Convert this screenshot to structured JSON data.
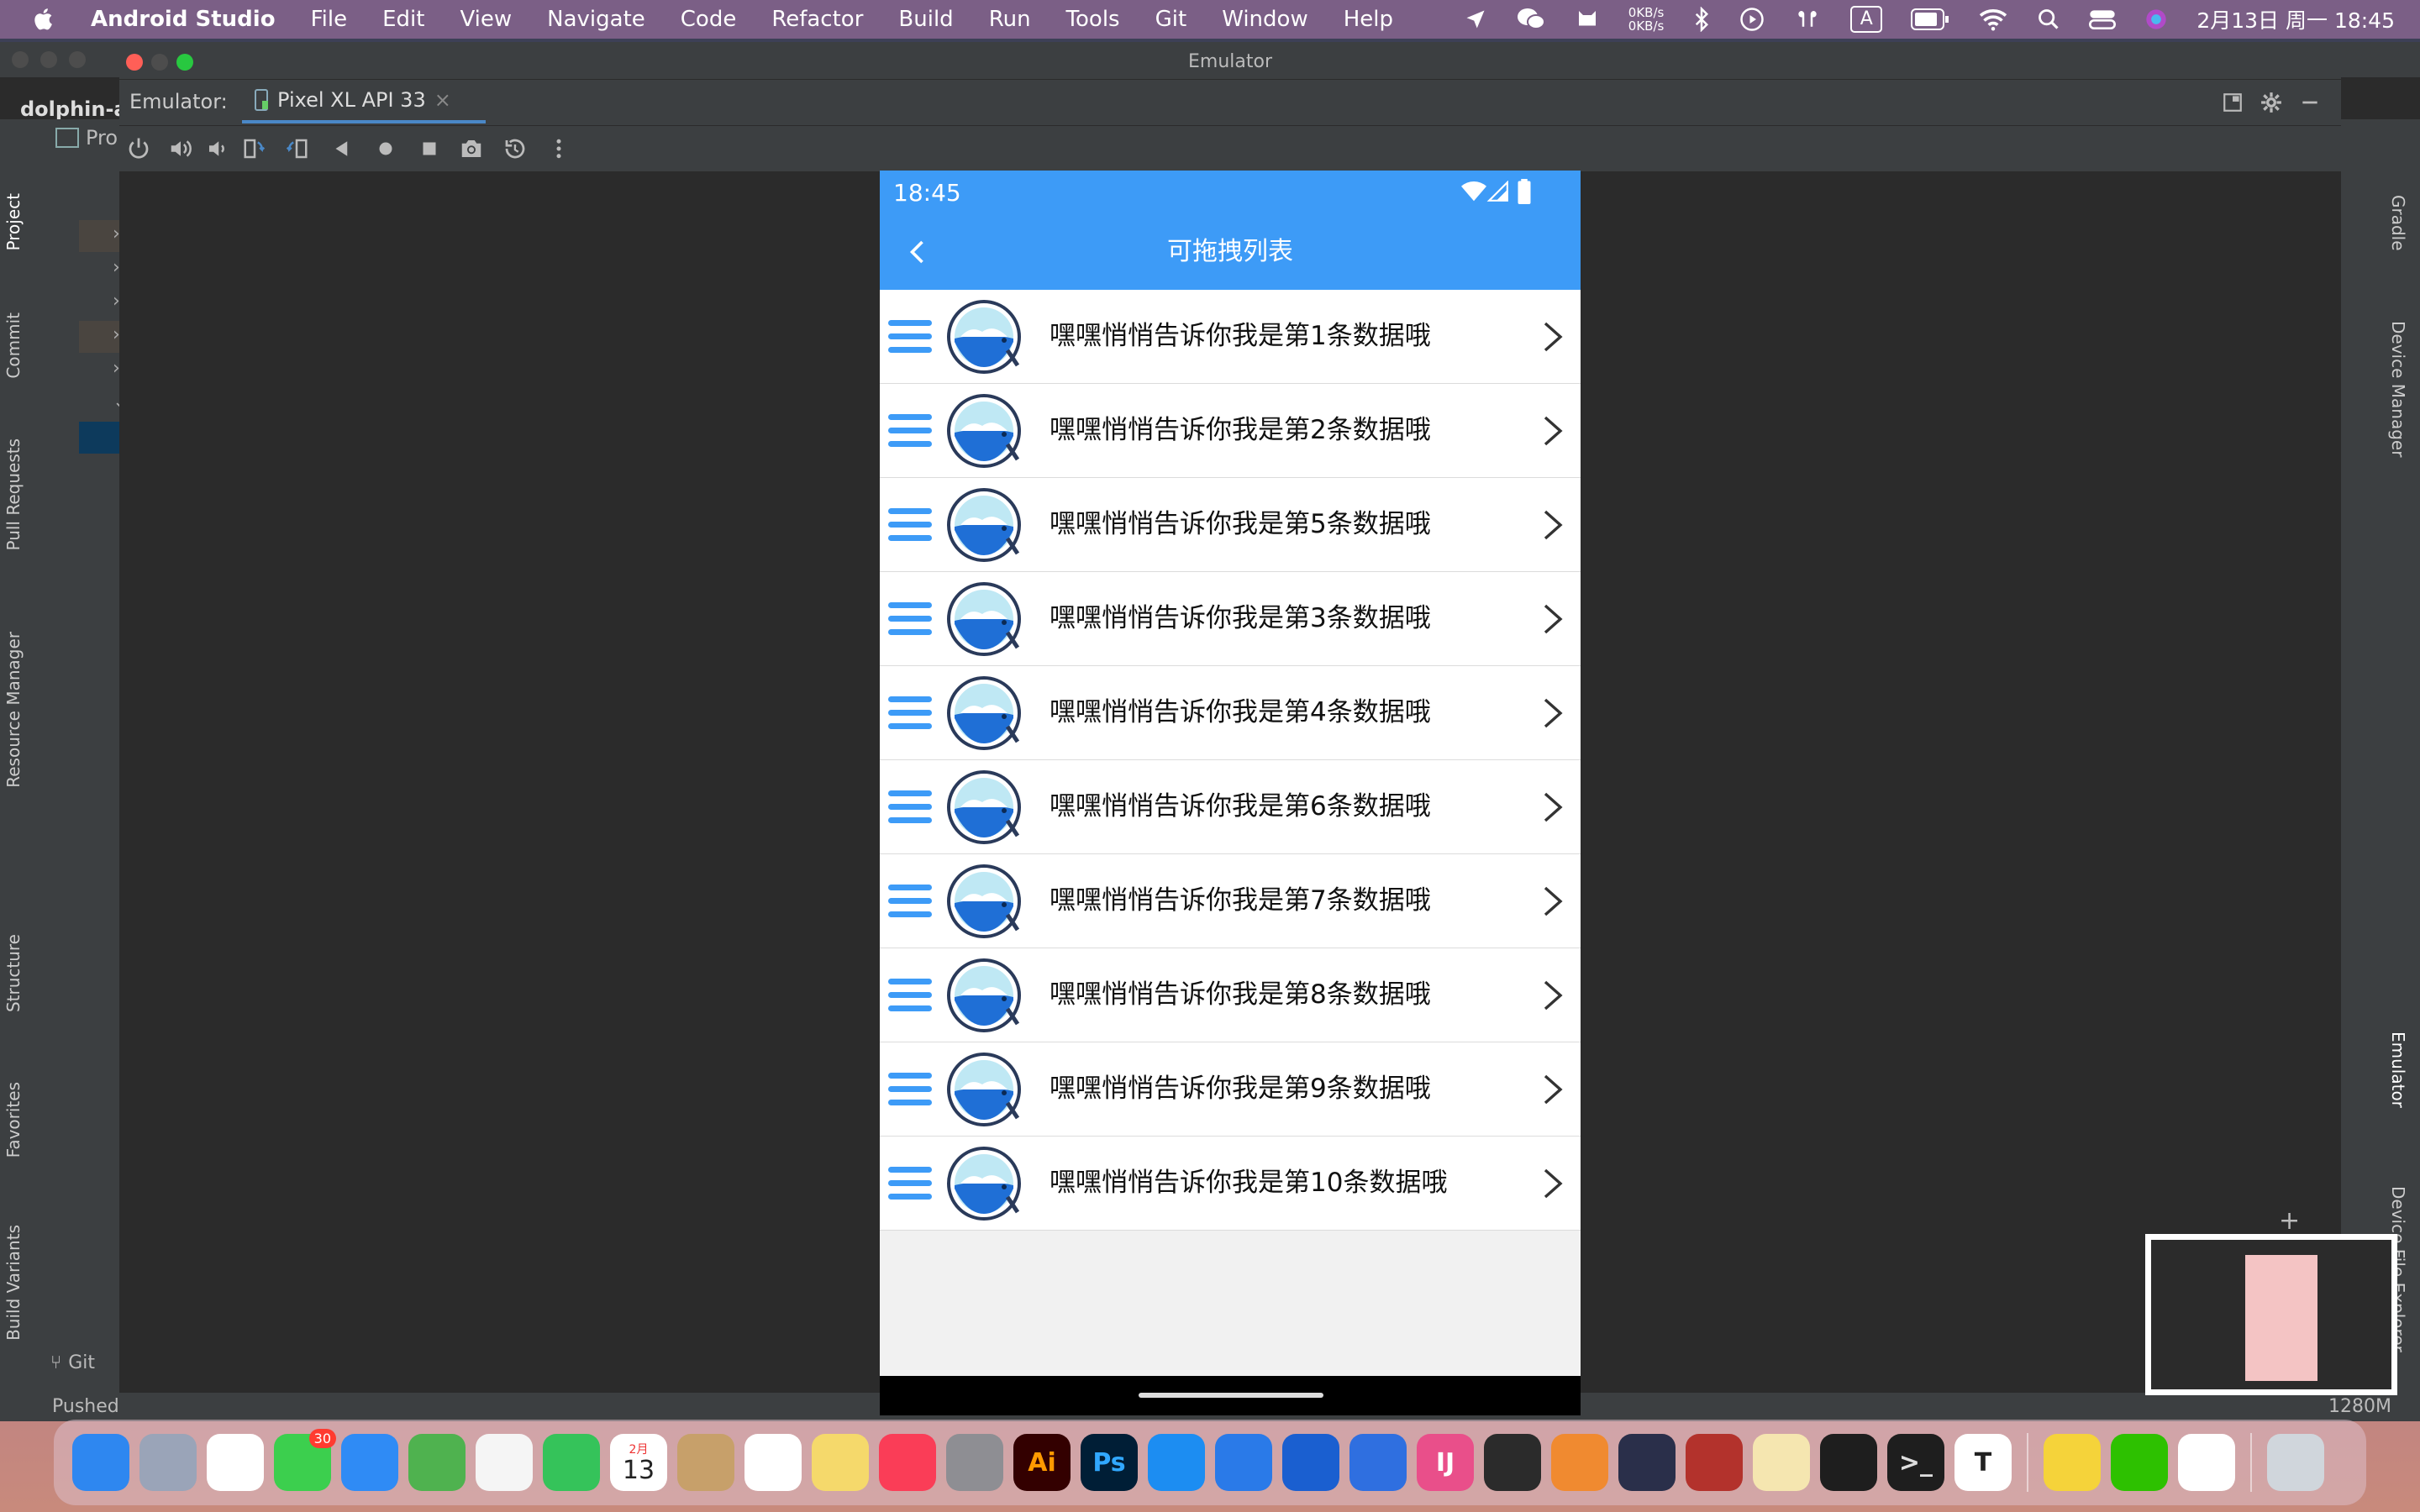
{
  "menubar": {
    "app_name": "Android Studio",
    "items": [
      "File",
      "Edit",
      "View",
      "Navigate",
      "Code",
      "Refactor",
      "Build",
      "Run",
      "Tools",
      "Git",
      "Window",
      "Help"
    ],
    "net_up": "0KB/s",
    "net_down": "0KB/s",
    "input_method": "A",
    "clock": "2月13日 周一  18:45"
  },
  "ide": {
    "project_name": "dolphin-a",
    "left_tabs": [
      "Project",
      "Commit",
      "Pull Requests",
      "Resource Manager",
      "Structure",
      "Favorites",
      "Build Variants"
    ],
    "right_tabs": [
      "Gradle",
      "Device Manager",
      "Emulator",
      "Device File Explorer"
    ],
    "git_label": "Git",
    "status_text": "Pushed",
    "memory": "1280M",
    "panel_fragment": "Pro"
  },
  "emulator": {
    "window_title": "Emulator",
    "label": "Emulator:",
    "device_tab": "Pixel XL API 33",
    "close_glyph": "×"
  },
  "phone": {
    "time": "18:45",
    "title": "可拖拽列表",
    "rows": [
      "嘿嘿悄悄告诉你我是第1条数据哦",
      "嘿嘿悄悄告诉你我是第2条数据哦",
      "嘿嘿悄悄告诉你我是第5条数据哦",
      "嘿嘿悄悄告诉你我是第3条数据哦",
      "嘿嘿悄悄告诉你我是第4条数据哦",
      "嘿嘿悄悄告诉你我是第6条数据哦",
      "嘿嘿悄悄告诉你我是第7条数据哦",
      "嘿嘿悄悄告诉你我是第8条数据哦",
      "嘿嘿悄悄告诉你我是第9条数据哦",
      "嘿嘿悄悄告诉你我是第10条数据哦"
    ]
  },
  "dock": {
    "messages_badge": "30",
    "calendar_month": "2月",
    "calendar_day": "13",
    "icons": [
      "finder-icon",
      "launchpad-icon",
      "chrome-icon",
      "messages-icon",
      "mail-icon",
      "maps-icon",
      "photos-icon",
      "facetime-icon",
      "calendar-icon",
      "contacts-icon",
      "reminders-icon",
      "notes-icon",
      "music-icon",
      "system-preferences-icon",
      "illustrator-icon",
      "photoshop-icon",
      "app-store-icon",
      "xcode-helper-icon",
      "xcode-icon",
      "instruments-icon",
      "intellij-icon",
      "android-studio-icon",
      "pencil-icon",
      "cloud-icon",
      "hex-app-icon",
      "paw-icon",
      "activity-monitor-icon",
      "terminal-icon",
      "typora-icon",
      "qq-music-icon",
      "wechat-icon",
      "qq-icon",
      "trash-icon"
    ]
  },
  "colors": {
    "accent": "#3d9bf7",
    "ide_bg": "#2b2b2b",
    "ide_panel": "#3c3f41"
  }
}
